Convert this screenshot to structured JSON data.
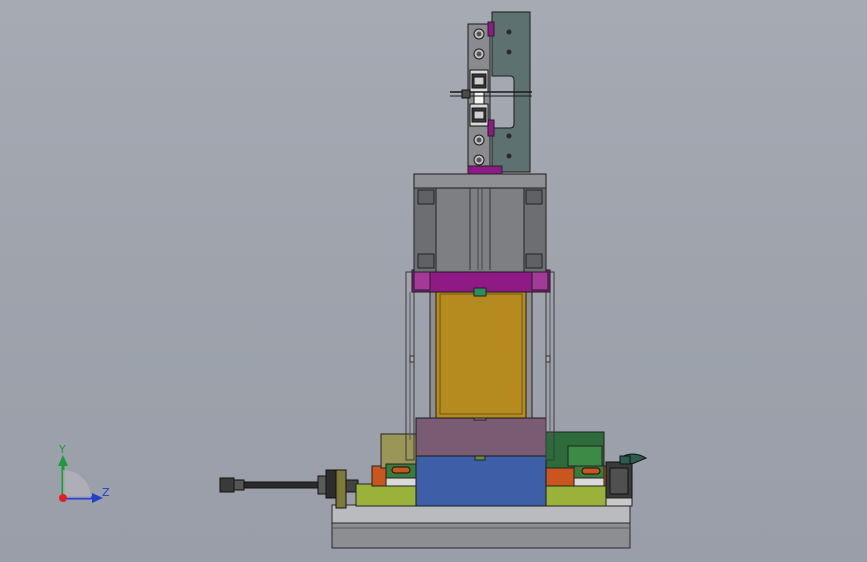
{
  "viewport": {
    "background_top": "#a6aab3",
    "background_bottom": "#999ea8"
  },
  "triad": {
    "y_label": "Y",
    "z_label": "Z",
    "x_color": "#e02020",
    "y_color": "#1f9a3a",
    "z_color": "#2440c8"
  },
  "model_colors": {
    "motor_gray": "#7d7f83",
    "bracket_plate": "#5d7270",
    "magenta": "#8f1a86",
    "gold": "#b58a1e",
    "mauve": "#7a5b74",
    "blue": "#3d5fa8",
    "olive": "#9a9658",
    "orange": "#c9561e",
    "green": "#2d6b3b",
    "yellow_green": "#9bb23a",
    "base_gray": "#8c8e92"
  }
}
